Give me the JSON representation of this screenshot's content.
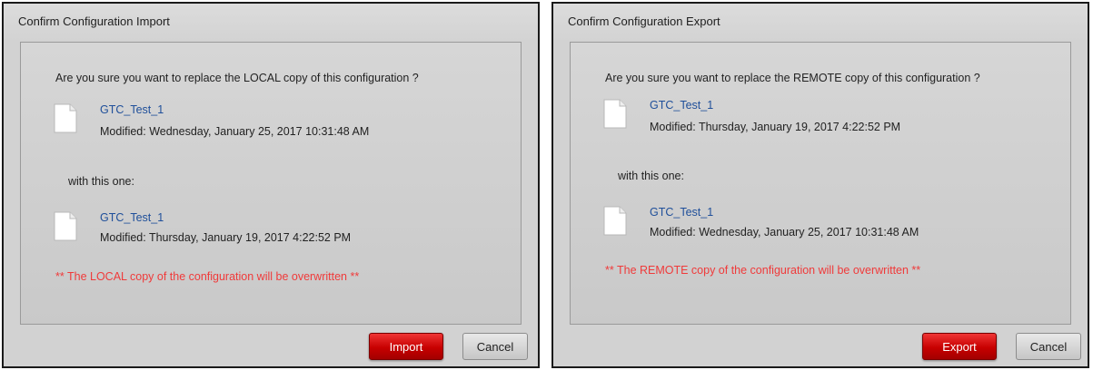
{
  "import_dialog": {
    "title": "Confirm Configuration Import",
    "question": "Are you sure you want to replace the LOCAL copy of this configuration ?",
    "current_file": {
      "icon": "document-icon",
      "name": "GTC_Test_1",
      "modified": "Modified: Wednesday, January 25, 2017 10:31:48 AM"
    },
    "with_label": "with this one:",
    "new_file": {
      "icon": "document-icon",
      "name": "GTC_Test_1",
      "modified": "Modified: Thursday, January 19, 2017 4:22:52 PM"
    },
    "warning": "** The LOCAL copy of the configuration will be overwritten **",
    "primary_button": "Import",
    "cancel_button": "Cancel"
  },
  "export_dialog": {
    "title": "Confirm Configuration Export",
    "question": "Are you sure you want to replace the REMOTE copy of this configuration ?",
    "current_file": {
      "icon": "document-icon",
      "name": "GTC_Test_1",
      "modified": "Modified: Thursday, January 19, 2017 4:22:52 PM"
    },
    "with_label": "with this one:",
    "new_file": {
      "icon": "document-icon",
      "name": "GTC_Test_1",
      "modified": "Modified: Wednesday, January 25, 2017 10:31:48 AM"
    },
    "warning": "** The REMOTE copy of the configuration will be overwritten **",
    "primary_button": "Export",
    "cancel_button": "Cancel"
  },
  "colors": {
    "primary_button": "#c70000",
    "file_name": "#1f4f9a",
    "warning_text": "#f03a3a"
  }
}
